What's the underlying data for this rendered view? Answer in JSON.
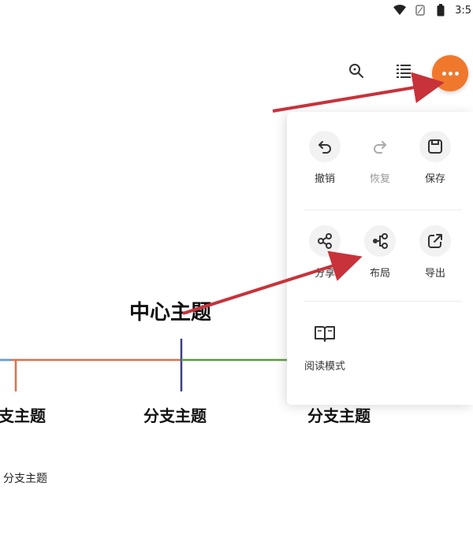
{
  "status_bar": {
    "time": "3:5",
    "icons": [
      "wifi-icon",
      "sim-icon",
      "battery-icon"
    ]
  },
  "toolbar": {
    "search_icon": "search-icon",
    "outline_icon": "list-icon",
    "more_icon": "more-dots-icon",
    "accent_color": "#f0782c"
  },
  "menu": {
    "row1": [
      {
        "label": "撤销",
        "icon": "undo-icon"
      },
      {
        "label": "恢复",
        "icon": "redo-icon",
        "disabled": true
      },
      {
        "label": "保存",
        "icon": "save-icon"
      }
    ],
    "row2": [
      {
        "label": "分享",
        "icon": "share-icon"
      },
      {
        "label": "布局",
        "icon": "layout-icon"
      },
      {
        "label": "导出",
        "icon": "export-icon"
      }
    ],
    "row3": [
      {
        "label": "阅读模式",
        "icon": "book-icon"
      }
    ]
  },
  "mindmap": {
    "center_topic": "中心主题",
    "branch_topics": [
      "支主题",
      "分支主题",
      "分支主题"
    ],
    "sub_topic": "分支主题"
  },
  "annotations": {
    "arrow_color": "#c8323a"
  }
}
